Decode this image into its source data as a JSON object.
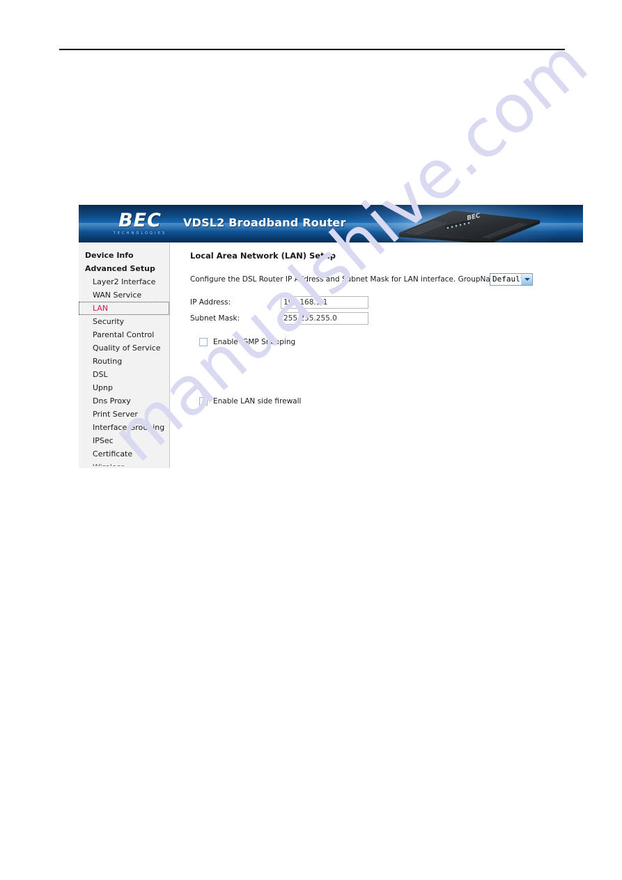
{
  "page": {
    "watermark": "manualshive.com"
  },
  "banner": {
    "logo_mark": "BEC",
    "logo_sub": "TECHNOLOGIES",
    "title": "VDSL2 Broadband Router",
    "product_photo": "router-product-photo"
  },
  "sidebar": {
    "items": [
      {
        "label": "Device Info",
        "level": 1,
        "selected": false
      },
      {
        "label": "Advanced Setup",
        "level": 1,
        "selected": false
      },
      {
        "label": "Layer2 Interface",
        "level": 2,
        "selected": false
      },
      {
        "label": "WAN Service",
        "level": 2,
        "selected": false
      },
      {
        "label": "LAN",
        "level": 2,
        "selected": true
      },
      {
        "label": "Security",
        "level": 2,
        "selected": false
      },
      {
        "label": "Parental Control",
        "level": 2,
        "selected": false
      },
      {
        "label": "Quality of Service",
        "level": 2,
        "selected": false
      },
      {
        "label": "Routing",
        "level": 2,
        "selected": false
      },
      {
        "label": "DSL",
        "level": 2,
        "selected": false
      },
      {
        "label": "Upnp",
        "level": 2,
        "selected": false
      },
      {
        "label": "Dns Proxy",
        "level": 2,
        "selected": false
      },
      {
        "label": "Print Server",
        "level": 2,
        "selected": false
      },
      {
        "label": "Interface Grouping",
        "level": 2,
        "selected": false
      },
      {
        "label": "IPSec",
        "level": 2,
        "selected": false
      },
      {
        "label": "Certificate",
        "level": 2,
        "selected": false
      },
      {
        "label": "Wireless",
        "level": 2,
        "selected": false,
        "clipped": true
      }
    ],
    "selected_color": "#d4145a"
  },
  "main": {
    "title": "Local Area Network (LAN) Setup",
    "description": "Configure the DSL Router IP Address and Subnet Mask for LAN interface.  GroupName",
    "group_name": {
      "label": "GroupName",
      "selected": "Default",
      "options": [
        "Default"
      ]
    },
    "fields": [
      {
        "label": "IP Address:",
        "value": "192.168.1.1"
      },
      {
        "label": "Subnet Mask:",
        "value": "255.255.255.0"
      }
    ],
    "checkboxes": [
      {
        "label": "Enable IGMP Snooping",
        "checked": false
      },
      {
        "label": "Enable LAN side firewall",
        "checked": false
      }
    ]
  }
}
